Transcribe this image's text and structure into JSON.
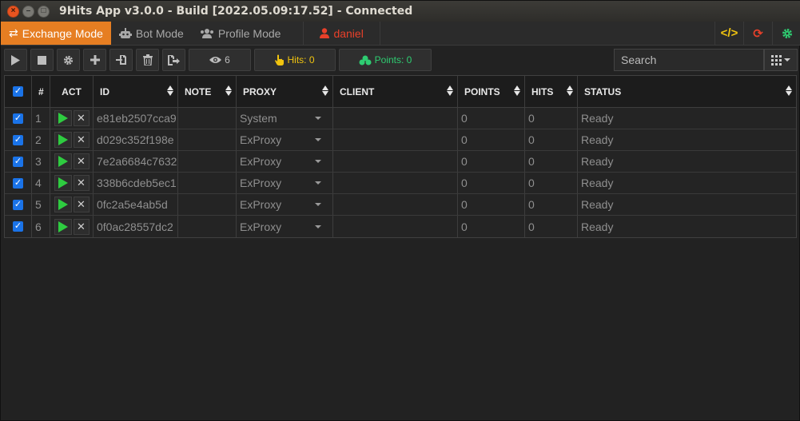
{
  "window": {
    "title": "9Hits App v3.0.0 - Build [2022.05.09:17.52] - Connected"
  },
  "nav": {
    "tabs": [
      {
        "label": "Exchange Mode",
        "icon": "exchange-icon",
        "active": true
      },
      {
        "label": "Bot Mode",
        "icon": "robot-icon",
        "active": false
      },
      {
        "label": "Profile Mode",
        "icon": "users-icon",
        "active": false
      }
    ],
    "user": "daniel",
    "right_icons": [
      "code-icon",
      "refresh-icon",
      "settings-gear-icon"
    ],
    "colors": {
      "accent": "#e67e22",
      "user": "#e8402a",
      "code": "#f1c40f",
      "refresh": "#e8402a",
      "gear": "#2ecc71"
    }
  },
  "toolbar": {
    "buttons": [
      "play-icon",
      "stop-icon",
      "gear-icon",
      "plus-icon",
      "import-icon",
      "trash-icon",
      "export-icon"
    ],
    "views": "6",
    "hits": "Hits: 0",
    "points": "Points: 0",
    "search_placeholder": "Search"
  },
  "table": {
    "columns": [
      "#",
      "ACT",
      "ID",
      "NOTE",
      "PROXY",
      "CLIENT",
      "POINTS",
      "HITS",
      "STATUS"
    ],
    "rows": [
      {
        "num": "1",
        "id": "e81eb2507cca9",
        "note": "",
        "proxy": "System",
        "client": "",
        "points": "0",
        "hits": "0",
        "status": "Ready"
      },
      {
        "num": "2",
        "id": "d029c352f198e",
        "note": "",
        "proxy": "ExProxy",
        "client": "",
        "points": "0",
        "hits": "0",
        "status": "Ready"
      },
      {
        "num": "3",
        "id": "7e2a6684c7632",
        "note": "",
        "proxy": "ExProxy",
        "client": "",
        "points": "0",
        "hits": "0",
        "status": "Ready"
      },
      {
        "num": "4",
        "id": "338b6cdeb5ec1",
        "note": "",
        "proxy": "ExProxy",
        "client": "",
        "points": "0",
        "hits": "0",
        "status": "Ready"
      },
      {
        "num": "5",
        "id": "0fc2a5e4ab5d",
        "note": "",
        "proxy": "ExProxy",
        "client": "",
        "points": "0",
        "hits": "0",
        "status": "Ready"
      },
      {
        "num": "6",
        "id": "0f0ac28557dc2",
        "note": "",
        "proxy": "ExProxy",
        "client": "",
        "points": "0",
        "hits": "0",
        "status": "Ready"
      }
    ]
  }
}
